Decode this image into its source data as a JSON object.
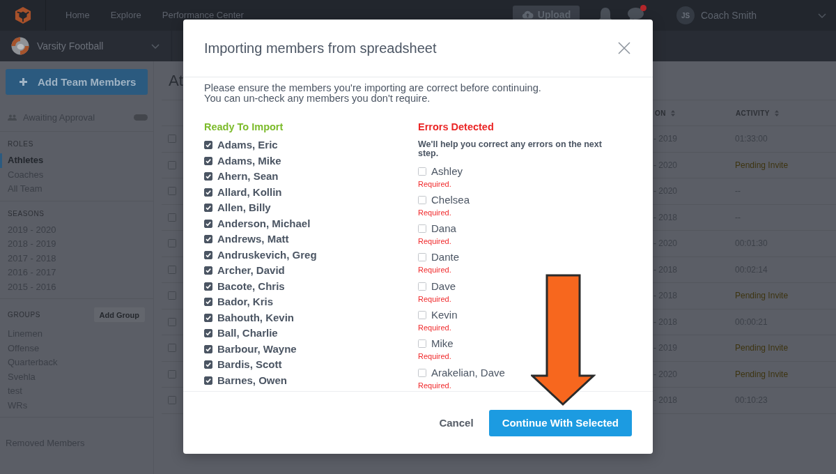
{
  "top_bar": {
    "nav": [
      {
        "label": "Home",
        "selected": false
      },
      {
        "label": "Explore",
        "selected": false
      },
      {
        "label": "Performance Center",
        "selected": false
      }
    ],
    "upload": "Upload",
    "messages_unread": true,
    "user": {
      "initials": "JS",
      "name": "Coach Smith"
    }
  },
  "team_bar": {
    "team": "Varsity Football"
  },
  "sidebar": {
    "add_button": "Add Team Members",
    "awaiting": "Awaiting Approval",
    "sections": [
      {
        "heading": "ROLES",
        "items": [
          {
            "label": "Athletes",
            "selected": true
          },
          {
            "label": "Coaches",
            "selected": false
          },
          {
            "label": "All Team",
            "selected": false
          }
        ]
      },
      {
        "heading": "SEASONS",
        "items": [
          {
            "label": "2019 - 2020",
            "selected": false
          },
          {
            "label": "2018 - 2019",
            "selected": false
          },
          {
            "label": "2017 - 2018",
            "selected": false
          },
          {
            "label": "2016 - 2017",
            "selected": false
          },
          {
            "label": "2015 - 2016",
            "selected": false
          }
        ]
      },
      {
        "heading": "GROUPS",
        "action": "Add Group",
        "items": [
          {
            "label": "Linemen",
            "selected": false
          },
          {
            "label": "Offense",
            "selected": false
          },
          {
            "label": "Quarterback",
            "selected": false
          },
          {
            "label": "Svehla",
            "selected": false
          },
          {
            "label": "test",
            "selected": false
          },
          {
            "label": "WRs",
            "selected": false
          }
        ]
      }
    ],
    "removed": "Removed Members"
  },
  "content": {
    "title": "At",
    "table": {
      "columns": [
        {
          "label": "ON"
        },
        {
          "label": "ACTIVITY"
        }
      ],
      "rows": [
        {
          "checked": false,
          "column_1": "- 2019",
          "activity": "01:33:00",
          "pending": false
        },
        {
          "checked": false,
          "column_1": "- 2020",
          "activity": "Pending Invite",
          "pending": true
        },
        {
          "checked": false,
          "column_1": "- 2020",
          "activity": "--",
          "pending": false
        },
        {
          "checked": false,
          "column_1": "- 2018",
          "activity": "--",
          "pending": false
        },
        {
          "checked": false,
          "column_1": "- 2020",
          "activity": "00:01:30",
          "pending": false
        },
        {
          "checked": false,
          "column_1": "- 2018",
          "activity": "00:02:14",
          "pending": false
        },
        {
          "checked": false,
          "column_1": "- 2018",
          "activity": "Pending Invite",
          "pending": true
        },
        {
          "checked": false,
          "column_1": "- 2018",
          "activity": "00:00:21",
          "pending": false
        },
        {
          "checked": false,
          "column_1": "- 2019",
          "activity": "Pending Invite",
          "pending": true
        },
        {
          "checked": false,
          "column_1": "- 2020",
          "activity": "Pending Invite",
          "pending": true
        },
        {
          "checked": false,
          "column_1": "- 2018",
          "activity": "00:10:23",
          "pending": false
        }
      ]
    }
  },
  "modal": {
    "title": "Importing members from spreadsheet",
    "intro": [
      "Please ensure the members you're importing are correct before continuing.",
      "You can un-check any members you don't require."
    ],
    "ready": {
      "heading": "Ready To Import",
      "members": [
        {
          "name": "Adams, Eric",
          "checked": true
        },
        {
          "name": "Adams, Mike",
          "checked": true
        },
        {
          "name": "Ahern, Sean",
          "checked": true
        },
        {
          "name": "Allard, Kollin",
          "checked": true
        },
        {
          "name": "Allen, Billy",
          "checked": true
        },
        {
          "name": "Anderson, Michael",
          "checked": true
        },
        {
          "name": "Andrews, Matt",
          "checked": true
        },
        {
          "name": "Andruskevich, Greg",
          "checked": true
        },
        {
          "name": "Archer, David",
          "checked": true
        },
        {
          "name": "Bacote, Chris",
          "checked": true
        },
        {
          "name": "Bador, Kris",
          "checked": true
        },
        {
          "name": "Bahouth, Kevin",
          "checked": true
        },
        {
          "name": "Ball, Charlie",
          "checked": true
        },
        {
          "name": "Barbour, Wayne",
          "checked": true
        },
        {
          "name": "Bardis, Scott",
          "checked": true
        },
        {
          "name": "Barnes, Owen",
          "checked": true
        }
      ]
    },
    "errors": {
      "heading": "Errors Detected",
      "note": "We'll help you correct any errors on the next step.",
      "members": [
        {
          "name": "Ashley",
          "checked": false,
          "error": "Required."
        },
        {
          "name": "Chelsea",
          "checked": false,
          "error": "Required."
        },
        {
          "name": "Dana",
          "checked": false,
          "error": "Required."
        },
        {
          "name": "Dante",
          "checked": false,
          "error": "Required."
        },
        {
          "name": "Dave",
          "checked": false,
          "error": "Required."
        },
        {
          "name": "Kevin",
          "checked": false,
          "error": "Required."
        },
        {
          "name": "Mike",
          "checked": false,
          "error": "Required."
        },
        {
          "name": "Arakelian, Dave",
          "checked": false,
          "error": "Required."
        }
      ]
    },
    "buttons": {
      "cancel": "Cancel",
      "confirm": "Continue With Selected"
    }
  },
  "callout_arrow": true
}
